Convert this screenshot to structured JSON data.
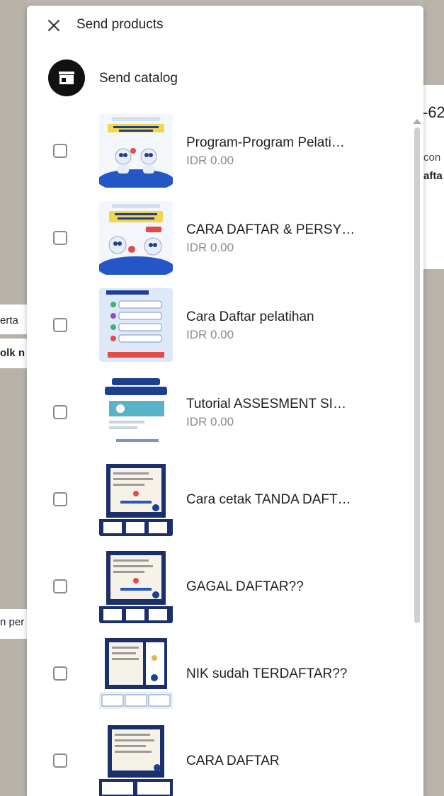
{
  "dialog": {
    "title": "Send products",
    "catalog_label": "Send catalog"
  },
  "items": [
    {
      "title": "Program-Program Pelati…",
      "price": "IDR 0.00",
      "thumb": "promo-program-pelatihan"
    },
    {
      "title": "CARA DAFTAR & PERSY…",
      "price": "IDR 0.00",
      "thumb": "promo-cara-daftar-persyaratan"
    },
    {
      "title": "Cara Daftar pelatihan",
      "price": "IDR 0.00",
      "thumb": "flow-cara-daftar"
    },
    {
      "title": "Tutorial ASSESMENT SI…",
      "price": "IDR 0.00",
      "thumb": "tutorial-pengisian"
    },
    {
      "title": "Cara cetak TANDA DAFT…",
      "price": "",
      "thumb": "screenshot-card"
    },
    {
      "title": "GAGAL DAFTAR??",
      "price": "",
      "thumb": "screenshot-card"
    },
    {
      "title": "NIK sudah TERDAFTAR??",
      "price": "",
      "thumb": "screenshot-card"
    },
    {
      "title": "CARA DAFTAR",
      "price": "",
      "thumb": "screenshot-card"
    }
  ],
  "background": {
    "right_texts": [
      "-62",
      "con",
      "afta"
    ],
    "left_texts": [
      "erta",
      "olk n",
      "n per"
    ]
  },
  "colors": {
    "accent_dark": "#111111",
    "thumb_blue": "#1d3f8f",
    "thumb_navy": "#1b2f6b"
  }
}
